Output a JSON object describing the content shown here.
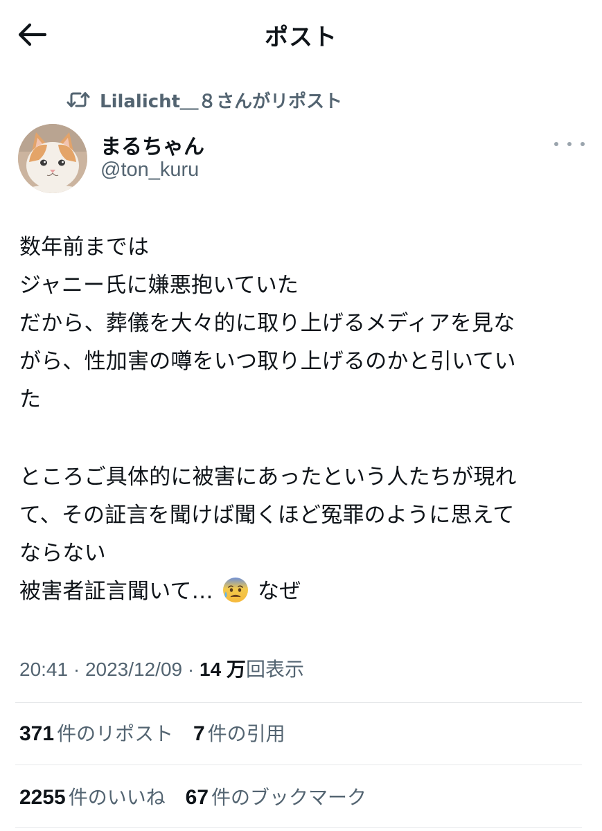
{
  "header": {
    "title": "ポスト",
    "back_icon": "arrow-left-icon"
  },
  "repost": {
    "icon": "repost-icon",
    "text": "Lilalicht＿８さんがリポスト"
  },
  "author": {
    "display_name": "まるちゃん",
    "handle": "@ton_kuru",
    "avatar": "cat-avatar"
  },
  "post": {
    "lines": [
      "数年前までは",
      "ジャニー氏に嫌悪抱いていた",
      "だから、葬儀を大々的に取り上げるメディアを見な",
      "がら、性加害の噂をいつ取り上げるのかと引いてい",
      "た",
      "",
      "ところご具体的に被害にあったという人たちが現れ",
      "て、その証言を聞けば聞くほど冤罪のように思えて",
      "ならない"
    ],
    "last_line_before": "被害者証言聞いて…",
    "last_line_emoji": "anxious-face-with-sweat-emoji",
    "last_line_after": "なぜ"
  },
  "meta": {
    "time": "20:41",
    "separator": "·",
    "date": "2023/12/09",
    "views_count": "14 万",
    "views_label": "回表示"
  },
  "stats": {
    "reposts_count": "371",
    "reposts_label": "件のリポスト",
    "quotes_count": "7",
    "quotes_label": "件の引用",
    "likes_count": "2255",
    "likes_label": "件のいいね",
    "bookmarks_count": "67",
    "bookmarks_label": "件のブックマーク"
  },
  "colors": {
    "text_primary": "#0f1419",
    "text_secondary": "#536471",
    "divider": "#e6e8ea"
  }
}
